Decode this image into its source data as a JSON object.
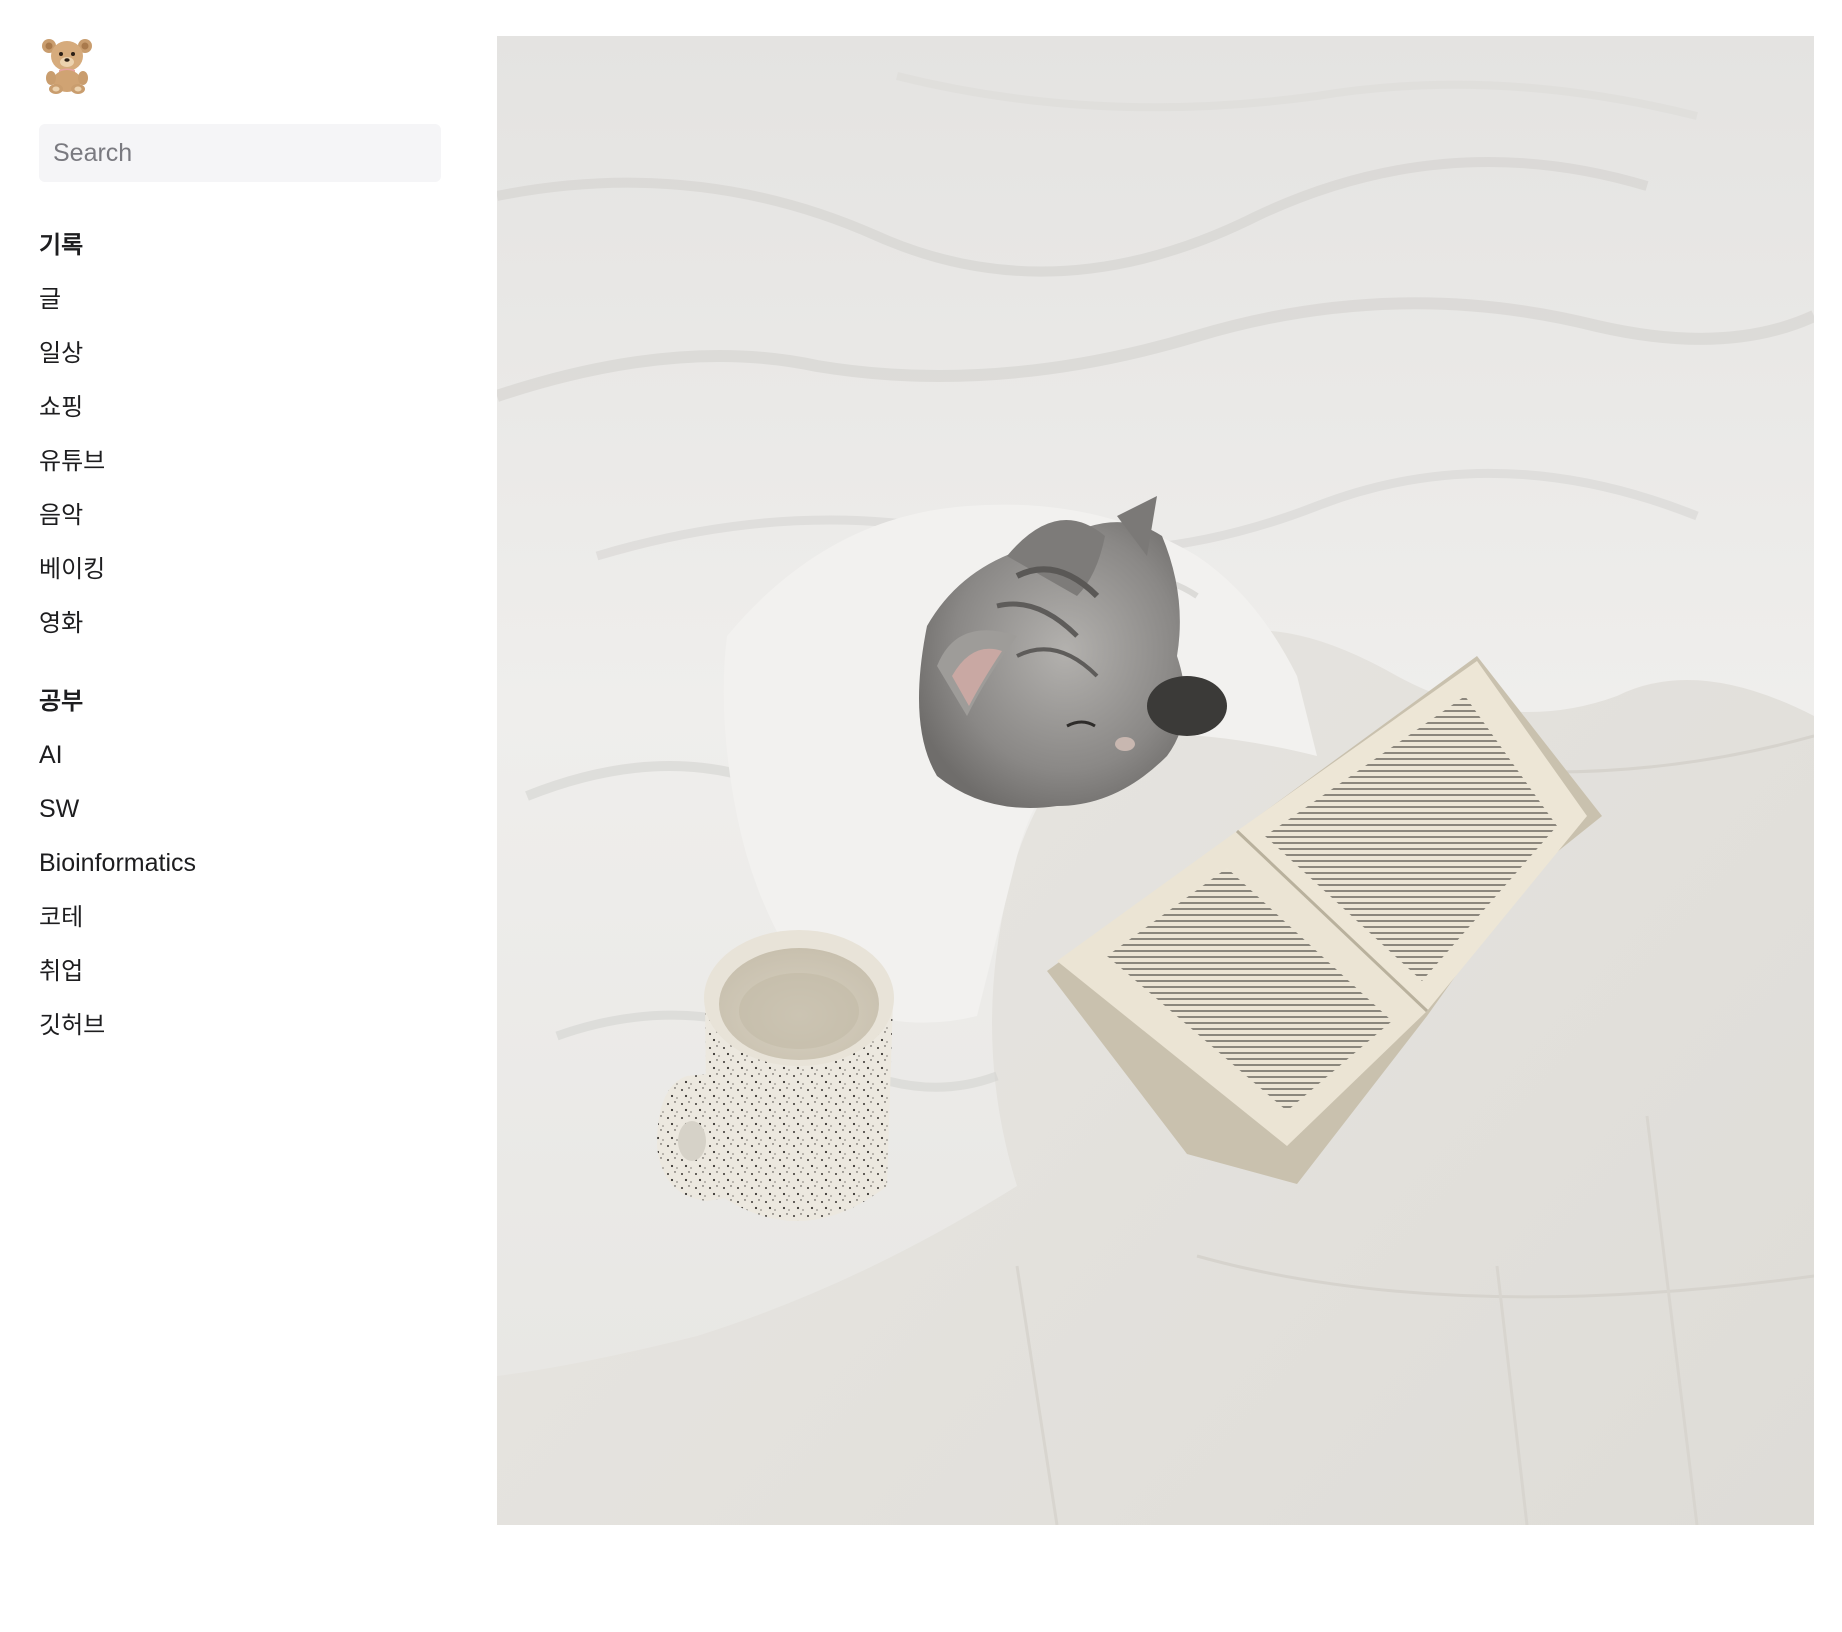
{
  "logo": {
    "icon": "teddy-bear-icon"
  },
  "search": {
    "placeholder": "Search",
    "value": ""
  },
  "sections": [
    {
      "title": "기록",
      "items": [
        "글",
        "일상",
        "쇼핑",
        "유튜브",
        "음악",
        "베이킹",
        "영화"
      ]
    },
    {
      "title": "공부",
      "items": [
        "AI",
        "SW",
        "Bioinformatics",
        "코테",
        "취업",
        "깃허브"
      ]
    }
  ],
  "hero": {
    "subject": "cat-under-blanket-with-book-and-mug",
    "colors": {
      "sheet": "#eeedeb",
      "mattress": "#ebe9e4",
      "cat": "#8f8e8c",
      "page": "#e9e1cf",
      "mug": "#e6e2d8"
    }
  }
}
